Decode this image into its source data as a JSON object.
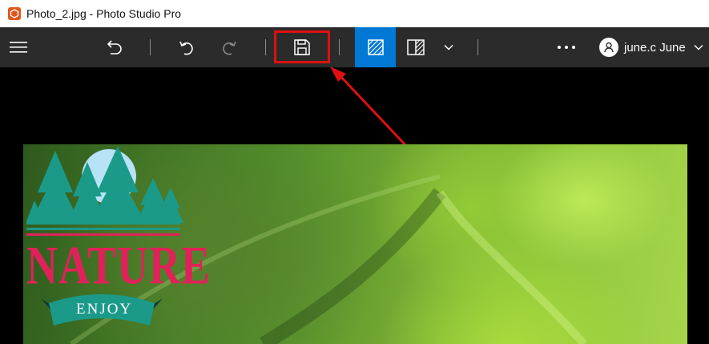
{
  "window": {
    "title": "Photo_2.jpg - Photo Studio Pro"
  },
  "toolbar": {
    "menu_icon": "hamburger-icon",
    "buttons": [
      "back-icon",
      "undo-icon",
      "redo-icon",
      "save-icon",
      "compare-side-icon",
      "split-view-icon",
      "chevron-down-icon",
      "more-icon"
    ],
    "more_label": "•••"
  },
  "user": {
    "name": "june.c June"
  },
  "image": {
    "logo_title": "NATURE",
    "logo_subtitle": "ENJOY"
  },
  "colors": {
    "accent": "#0078d4",
    "highlight": "#e01010",
    "logo_pink": "#e0225a",
    "logo_teal": "#1b9a8a"
  }
}
